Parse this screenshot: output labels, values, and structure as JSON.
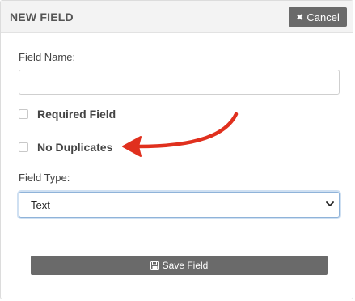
{
  "header": {
    "title": "NEW FIELD",
    "cancel_label": "Cancel",
    "cancel_icon": "close-icon"
  },
  "form": {
    "field_name_label": "Field Name:",
    "field_name_value": "",
    "required_label": "Required Field",
    "required_checked": false,
    "no_duplicates_label": "No Duplicates",
    "no_duplicates_checked": false,
    "field_type_label": "Field Type:",
    "field_type_selected": "Text"
  },
  "footer": {
    "save_label": "Save Field",
    "save_icon": "floppy-disk-icon"
  },
  "annotation": {
    "arrow_color": "#e0301e",
    "arrow_target": "No Duplicates"
  },
  "colors": {
    "button_bg": "#6a6a6a",
    "header_bg": "#f3f3f3",
    "select_focus": "#8fb3d9"
  }
}
